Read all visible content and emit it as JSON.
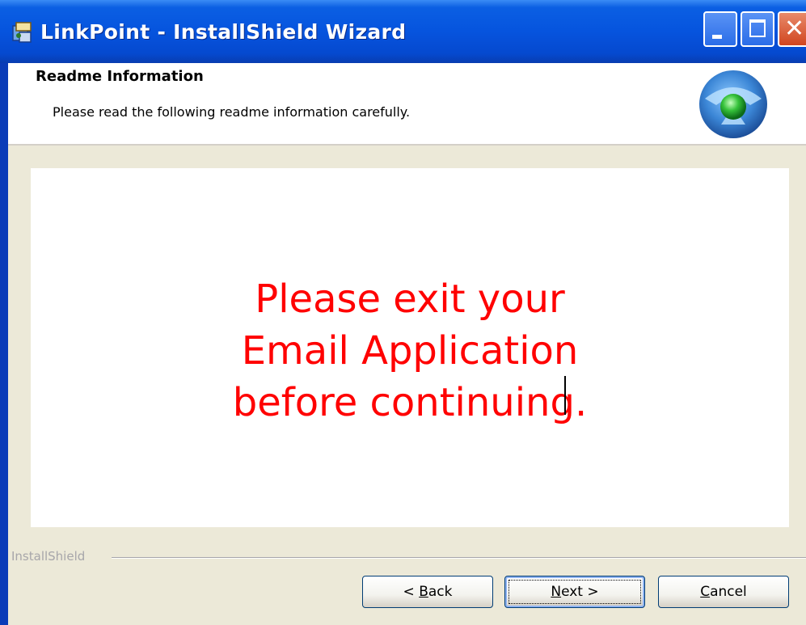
{
  "window": {
    "title": "LinkPoint - InstallShield Wizard",
    "icon": "installer-icon",
    "controls": [
      "minimize-icon",
      "maximize-icon",
      "close-icon"
    ]
  },
  "header": {
    "title": "Readme Information",
    "subtitle": "Please read the following readme information carefully.",
    "logo": "installshield-logo-icon"
  },
  "readme": {
    "lines": [
      "Please exit your",
      "Email Application",
      "before continuing."
    ],
    "text_color": "#ff0000"
  },
  "footer": {
    "brand": "InstallShield",
    "buttons": {
      "back_prefix": "< ",
      "back_mnemonic": "B",
      "back_rest": "ack",
      "next_mnemonic": "N",
      "next_rest": "ext >",
      "cancel_mnemonic": "C",
      "cancel_rest": "ancel"
    }
  },
  "colors": {
    "titlebar": "#0654de",
    "dialog_bg": "#ece9d8",
    "accent_text": "#ff0000"
  }
}
